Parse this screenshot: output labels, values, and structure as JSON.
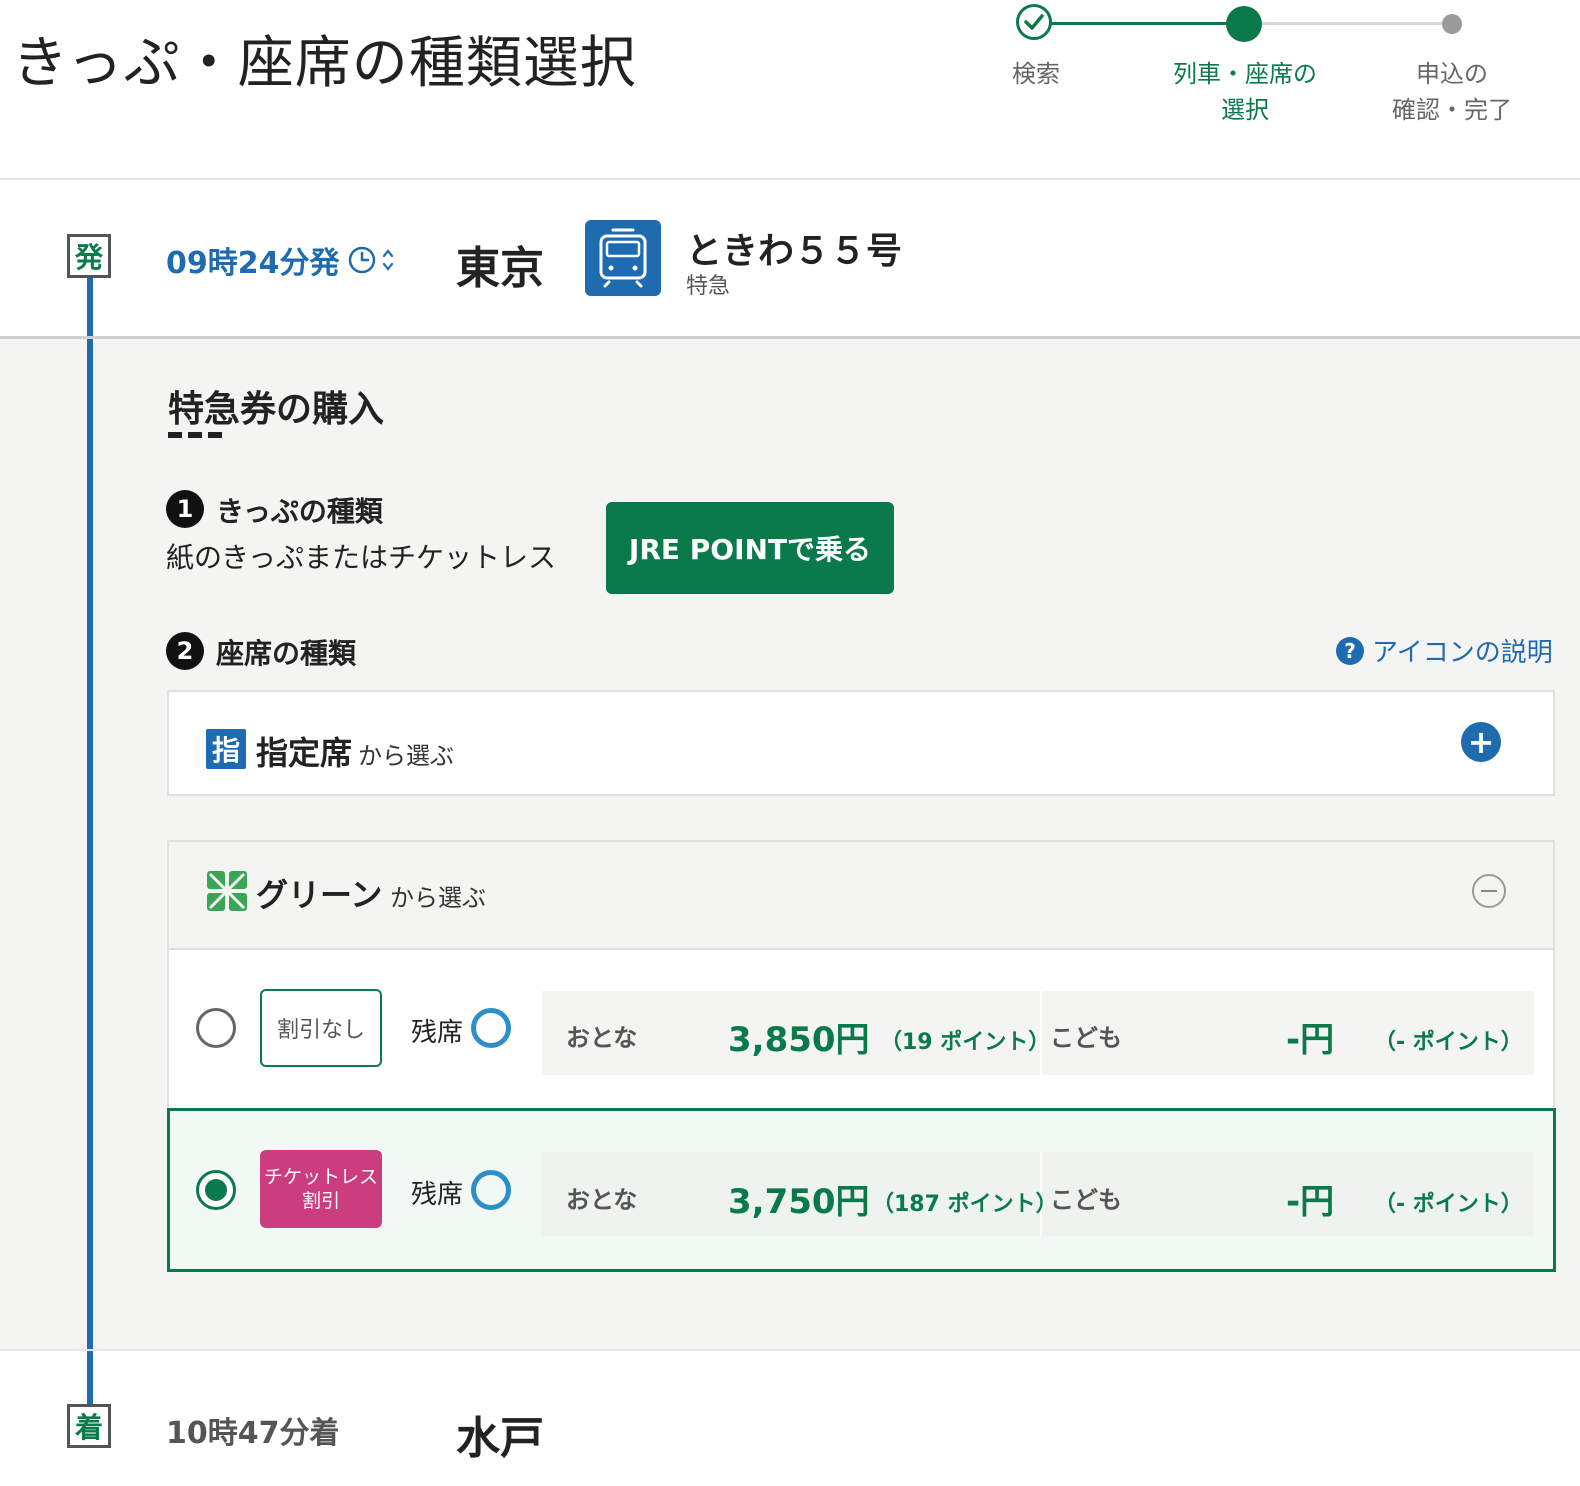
{
  "header": {
    "title": "きっぷ・座席の種類選択",
    "steps": [
      {
        "label_line1": "検索",
        "label_line2": "",
        "status": "done"
      },
      {
        "label_line1": "列車・座席の",
        "label_line2": "選択",
        "status": "current"
      },
      {
        "label_line1": "申込の",
        "label_line2": "確認・完了",
        "status": "todo"
      }
    ]
  },
  "departure": {
    "badge": "発",
    "time": "09時24分発",
    "station": "東京",
    "train_name": "ときわ５５号",
    "train_type": "特急"
  },
  "purchase": {
    "section_title": "特急券の購入",
    "ticket_kind": {
      "number": "1",
      "title": "きっぷの種類",
      "value": "紙のきっぷまたはチケットレス",
      "jre_button": "JRE POINTで乗る"
    },
    "seat_kind": {
      "number": "2",
      "title": "座席の種類",
      "help_link": "アイコンの説明"
    },
    "reserved": {
      "icon_char": "指",
      "label": "指定席",
      "suffix": "から選ぶ",
      "expanded": false
    },
    "green": {
      "label": "グリーン",
      "suffix": "から選ぶ",
      "expanded": true,
      "options": [
        {
          "tag": "割引なし",
          "selected": false,
          "seat_label": "残席",
          "adult_label": "おとな",
          "adult_price": "3,850円",
          "adult_points": "（19 ポイント）",
          "child_label": "こども",
          "child_price": "-円",
          "child_points": "（- ポイント）"
        },
        {
          "tag_line1": "チケットレス",
          "tag_line2": "割引",
          "selected": true,
          "seat_label": "残席",
          "adult_label": "おとな",
          "adult_price": "3,750円",
          "adult_points": "（187 ポイント）",
          "child_label": "こども",
          "child_price": "-円",
          "child_points": "（- ポイント）"
        }
      ]
    }
  },
  "arrival": {
    "badge": "着",
    "time": "10時47分着",
    "station": "水戸"
  },
  "colors": {
    "brand_green": "#0b7a4b",
    "link_blue": "#1e6bb0",
    "ticketless_pink": "#cc3d7f",
    "seat_available": "#2d8fc7"
  }
}
